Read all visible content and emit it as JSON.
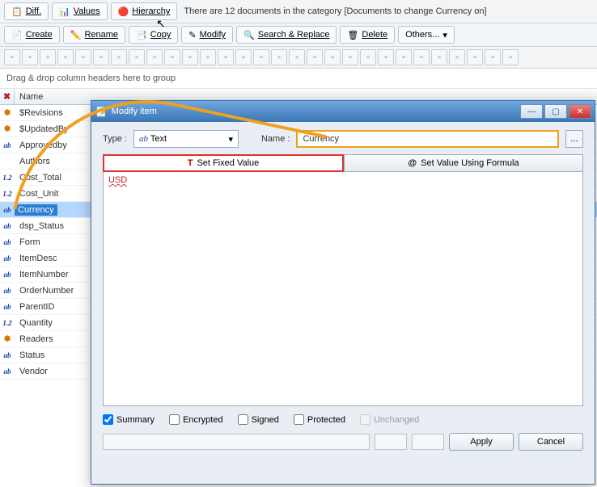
{
  "toolbar1": {
    "diff": "Diff.",
    "values": "Values",
    "hierarchy": "Hierarchy",
    "info": "There are 12 documents in the category [Documents to change Currency on]"
  },
  "toolbar2": {
    "create": "Create",
    "rename": "Rename",
    "copy": "Copy",
    "modify": "Modify",
    "search": "Search & Replace",
    "delete": "Delete",
    "others": "Others..."
  },
  "groupbar": "Drag & drop column headers here to group",
  "col_header": "Name",
  "fields": [
    {
      "type": "spec",
      "label": "$Revisions"
    },
    {
      "type": "spec",
      "label": "$UpdatedBy"
    },
    {
      "type": "ab",
      "label": "Approvedby"
    },
    {
      "type": "none",
      "label": "Authors"
    },
    {
      "type": "12",
      "label": "Cost_Total"
    },
    {
      "type": "12",
      "label": "Cost_Unit"
    },
    {
      "type": "ab",
      "label": "Currency",
      "selected": true
    },
    {
      "type": "ab",
      "label": "dsp_Status"
    },
    {
      "type": "ab",
      "label": "Form"
    },
    {
      "type": "ab",
      "label": "ItemDesc"
    },
    {
      "type": "ab",
      "label": "ItemNumber"
    },
    {
      "type": "ab",
      "label": "OrderNumber"
    },
    {
      "type": "ab",
      "label": "ParentID"
    },
    {
      "type": "12",
      "label": "Quantity"
    },
    {
      "type": "spec",
      "label": "Readers"
    },
    {
      "type": "ab",
      "label": "Status"
    },
    {
      "type": "ab",
      "label": "Vendor"
    }
  ],
  "dialog": {
    "title": "Modify item",
    "type_label": "Type :",
    "type_value": "Text",
    "name_label": "Name :",
    "name_value": "Currency",
    "tab_fixed": "Set Fixed Value",
    "tab_formula": "Set Value Using Formula",
    "value": "USD",
    "chk_summary": "Summary",
    "chk_encrypted": "Encrypted",
    "chk_signed": "Signed",
    "chk_protected": "Protected",
    "chk_unchanged": "Unchanged",
    "btn_apply": "Apply",
    "btn_cancel": "Cancel"
  }
}
